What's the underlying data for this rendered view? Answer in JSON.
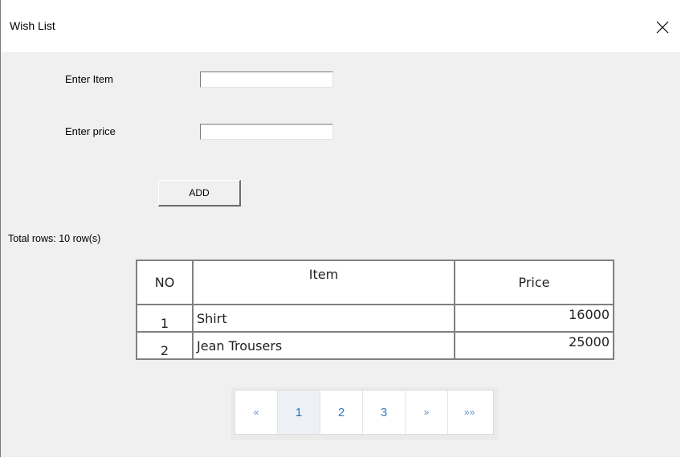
{
  "window": {
    "title": "Wish List"
  },
  "form": {
    "item_label": "Enter Item",
    "price_label": "Enter price",
    "item_value": "",
    "price_value": "",
    "add_button": "ADD"
  },
  "summary": {
    "total_rows": "Total rows: 10 row(s)"
  },
  "table": {
    "headers": {
      "no": "NO",
      "item": "Item",
      "price": "Price"
    },
    "rows": [
      {
        "no": "1",
        "item": "Shirt",
        "price": "16000"
      },
      {
        "no": "2",
        "item": "Jean Trousers",
        "price": "25000"
      }
    ]
  },
  "pagination": {
    "items": [
      {
        "label": "«",
        "kind": "nav"
      },
      {
        "label": "1",
        "kind": "page",
        "active": true
      },
      {
        "label": "2",
        "kind": "page"
      },
      {
        "label": "3",
        "kind": "page"
      },
      {
        "label": "»",
        "kind": "nav"
      },
      {
        "label": "»»",
        "kind": "nav"
      }
    ]
  }
}
